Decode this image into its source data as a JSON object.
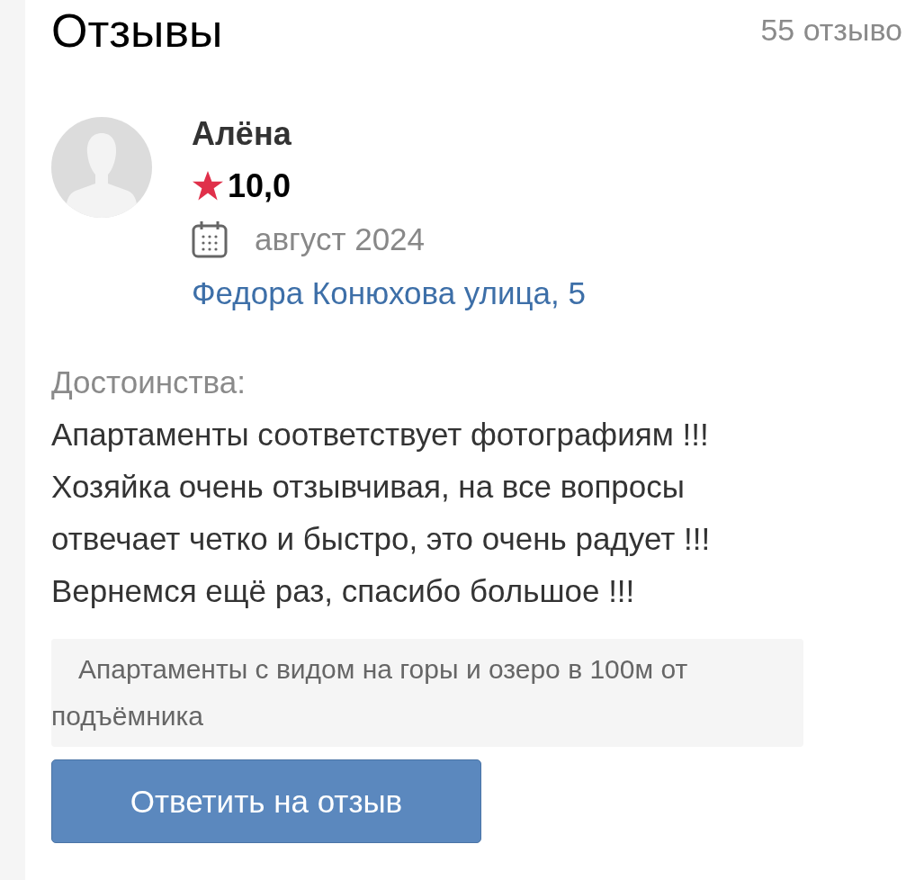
{
  "header": {
    "title": "Отзывы",
    "count": "55 отзыво"
  },
  "review": {
    "author": "Алёна",
    "rating": "10,0",
    "date": "август 2024",
    "property_link": "Федора Конюхова улица, 5",
    "pros_label": "Достоинства:",
    "pros_text": "Апартаменты соответствует фотографиям !!!\nХозяйка очень отзывчивая, на все вопросы\nотвечает четко и быстро, это очень радует !!!\nВернемся ещё раз, спасибо большое !!!",
    "listing_tag": "Апартаменты с видом на горы и озеро в 100м от подъёмника",
    "reply_button": "Ответить на отзыв"
  }
}
